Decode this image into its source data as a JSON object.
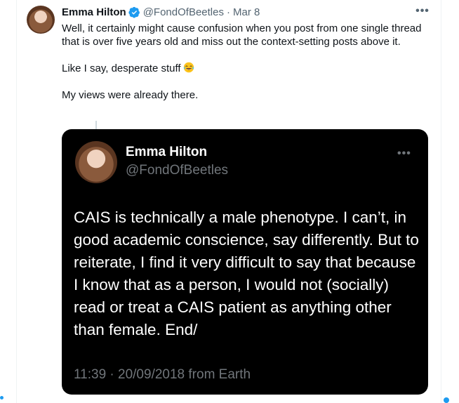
{
  "tweet": {
    "author_name": "Emma Hilton",
    "handle": "@FondOfBeetles",
    "separator": "·",
    "date": "Mar 8",
    "more_label": "•••",
    "paragraphs": [
      "Well, it certainly might cause confusion when you post from one single thread that is over five years old and miss out the context-setting posts above it.",
      "Like I say, desperate stuff",
      "My views were already there."
    ],
    "emoji_icon": "face-with-tears-of-joy-icon"
  },
  "quoted": {
    "author_name": "Emma Hilton",
    "handle": "@FondOfBeetles",
    "more_label": "•••",
    "text": "CAIS is technically a male phenotype. I can’t, in good academic conscience, say differently. But to reiterate, I find it very difficult to say that because I know that as a person, I would not (socially) read or treat a CAIS patient as anything other than female. End/",
    "meta": "11:39 · 20/09/2018 from Earth"
  },
  "colors": {
    "verified_blue": "#1d9bf0",
    "text_primary": "#0f1419",
    "text_secondary": "#536471",
    "card_bg": "#000000",
    "card_muted": "#71767b"
  }
}
